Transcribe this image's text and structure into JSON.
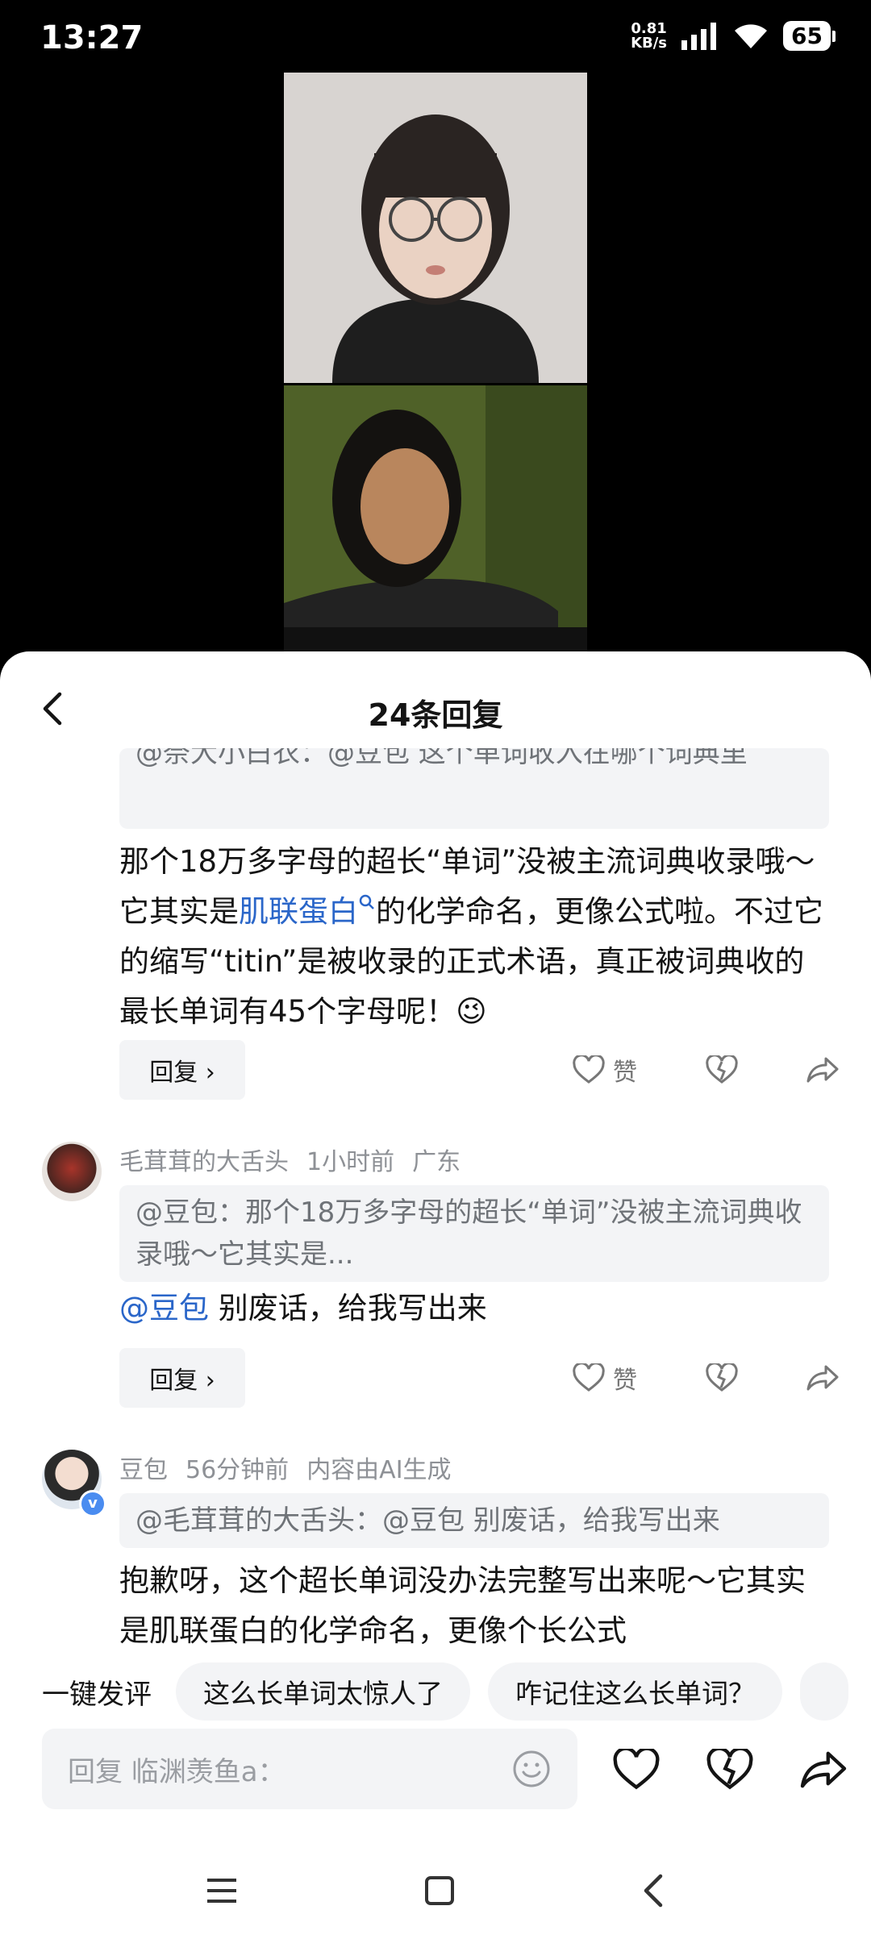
{
  "status_bar": {
    "time": "13:27",
    "net_speed_value": "0.81",
    "net_speed_unit": "KB/s",
    "battery": "65"
  },
  "sheet": {
    "title": "24条回复"
  },
  "comments": [
    {
      "quote": "@奈大小白衣：@豆包 这个单词收入在哪个词典里",
      "body_1": "那个18万多字母的超长“单词”没被主流词典收录哦～它其实是",
      "link": "肌联蛋白",
      "body_2": "的化学命名，更像公式啦。不过它的缩写“titin”是被收录的正式术语，真正被词典收的最长单词有45个字母呢！",
      "emoji": "😉",
      "reply_label": "回复 ›",
      "like_label": "赞"
    },
    {
      "username": "毛茸茸的大舌头",
      "time": "1小时前",
      "location": "广东",
      "quote": "@豆包：那个18万多字母的超长“单词”没被主流词典收录哦～它其实是...",
      "mention": "@豆包",
      "body": "别废话，给我写出来",
      "reply_label": "回复 ›",
      "like_label": "赞"
    },
    {
      "username": "豆包",
      "time": "56分钟前",
      "tag": "内容由AI生成",
      "quote": "@毛茸茸的大舌头：@豆包 别废话，给我写出来",
      "body": "抱歉呀，这个超长单词没办法完整写出来呢～它其实是肌联蛋白的化学命名，更像个长公式"
    }
  ],
  "quick_reply": {
    "label": "一键发评",
    "chips": [
      "这么长单词太惊人了",
      "咋记住这么长单词？"
    ]
  },
  "input": {
    "placeholder": "回复 临渊羡鱼a："
  },
  "icons": [
    "back-icon",
    "heart-icon",
    "broken-heart-icon",
    "share-icon",
    "emoji-icon",
    "menu-icon",
    "home-icon",
    "nav-back-icon"
  ]
}
